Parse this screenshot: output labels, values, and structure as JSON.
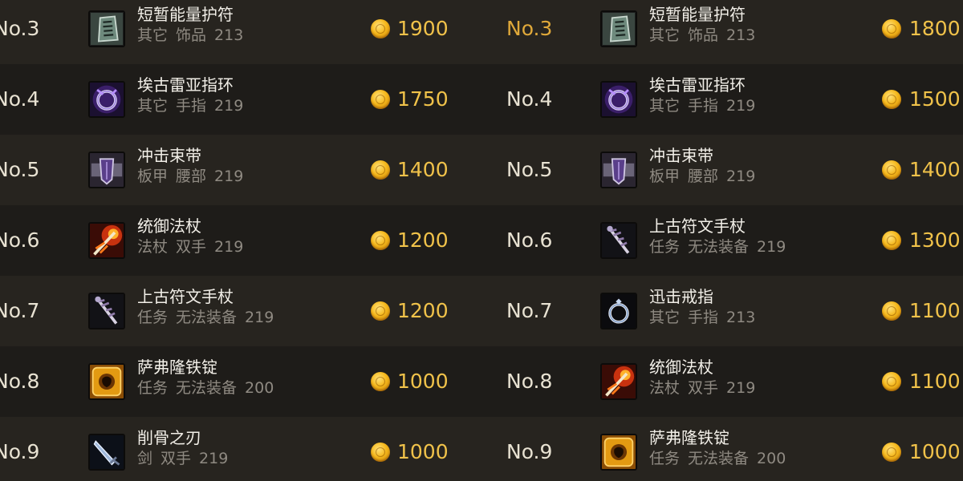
{
  "colors": {
    "rank_highlight": "#e0a93a",
    "rank_normal": "#e8e2d2",
    "price": "#f0c24a",
    "subtext": "#8f8a82"
  },
  "left": [
    {
      "rank": "No.3",
      "name": "短暂能量护符",
      "type": "其它",
      "slot": "饰品",
      "ilvl": "213",
      "price": "1900",
      "icon": "amulet-icon"
    },
    {
      "rank": "No.4",
      "name": "埃古雷亚指环",
      "type": "其它",
      "slot": "手指",
      "ilvl": "219",
      "price": "1750",
      "icon": "purple-ring-icon"
    },
    {
      "rank": "No.5",
      "name": "冲击束带",
      "type": "板甲",
      "slot": "腰部",
      "ilvl": "219",
      "price": "1400",
      "icon": "belt-icon"
    },
    {
      "rank": "No.6",
      "name": "统御法杖",
      "type": "法杖",
      "slot": "双手",
      "ilvl": "219",
      "price": "1200",
      "icon": "fire-staff-icon"
    },
    {
      "rank": "No.7",
      "name": "上古符文手杖",
      "type": "任务",
      "slot": "无法装备",
      "ilvl": "219",
      "price": "1200",
      "icon": "rune-staff-icon"
    },
    {
      "rank": "No.8",
      "name": "萨弗隆铁锭",
      "type": "任务",
      "slot": "无法装备",
      "ilvl": "200",
      "price": "1000",
      "icon": "ingot-icon"
    },
    {
      "rank": "No.9",
      "name": "削骨之刃",
      "type": "剑",
      "slot": "双手",
      "ilvl": "219",
      "price": "1000",
      "icon": "blade-icon"
    }
  ],
  "right": [
    {
      "rank": "No.3",
      "name": "短暂能量护符",
      "type": "其它",
      "slot": "饰品",
      "ilvl": "213",
      "price": "1800",
      "icon": "amulet-icon"
    },
    {
      "rank": "No.4",
      "name": "埃古雷亚指环",
      "type": "其它",
      "slot": "手指",
      "ilvl": "219",
      "price": "1500",
      "icon": "purple-ring-icon"
    },
    {
      "rank": "No.5",
      "name": "冲击束带",
      "type": "板甲",
      "slot": "腰部",
      "ilvl": "219",
      "price": "1400",
      "icon": "belt-icon"
    },
    {
      "rank": "No.6",
      "name": "上古符文手杖",
      "type": "任务",
      "slot": "无法装备",
      "ilvl": "219",
      "price": "1300",
      "icon": "rune-staff-icon"
    },
    {
      "rank": "No.7",
      "name": "迅击戒指",
      "type": "其它",
      "slot": "手指",
      "ilvl": "213",
      "price": "1100",
      "icon": "silver-ring-icon"
    },
    {
      "rank": "No.8",
      "name": "统御法杖",
      "type": "法杖",
      "slot": "双手",
      "ilvl": "219",
      "price": "1100",
      "icon": "fire-staff-icon"
    },
    {
      "rank": "No.9",
      "name": "萨弗隆铁锭",
      "type": "任务",
      "slot": "无法装备",
      "ilvl": "200",
      "price": "1000",
      "icon": "ingot-icon"
    }
  ]
}
